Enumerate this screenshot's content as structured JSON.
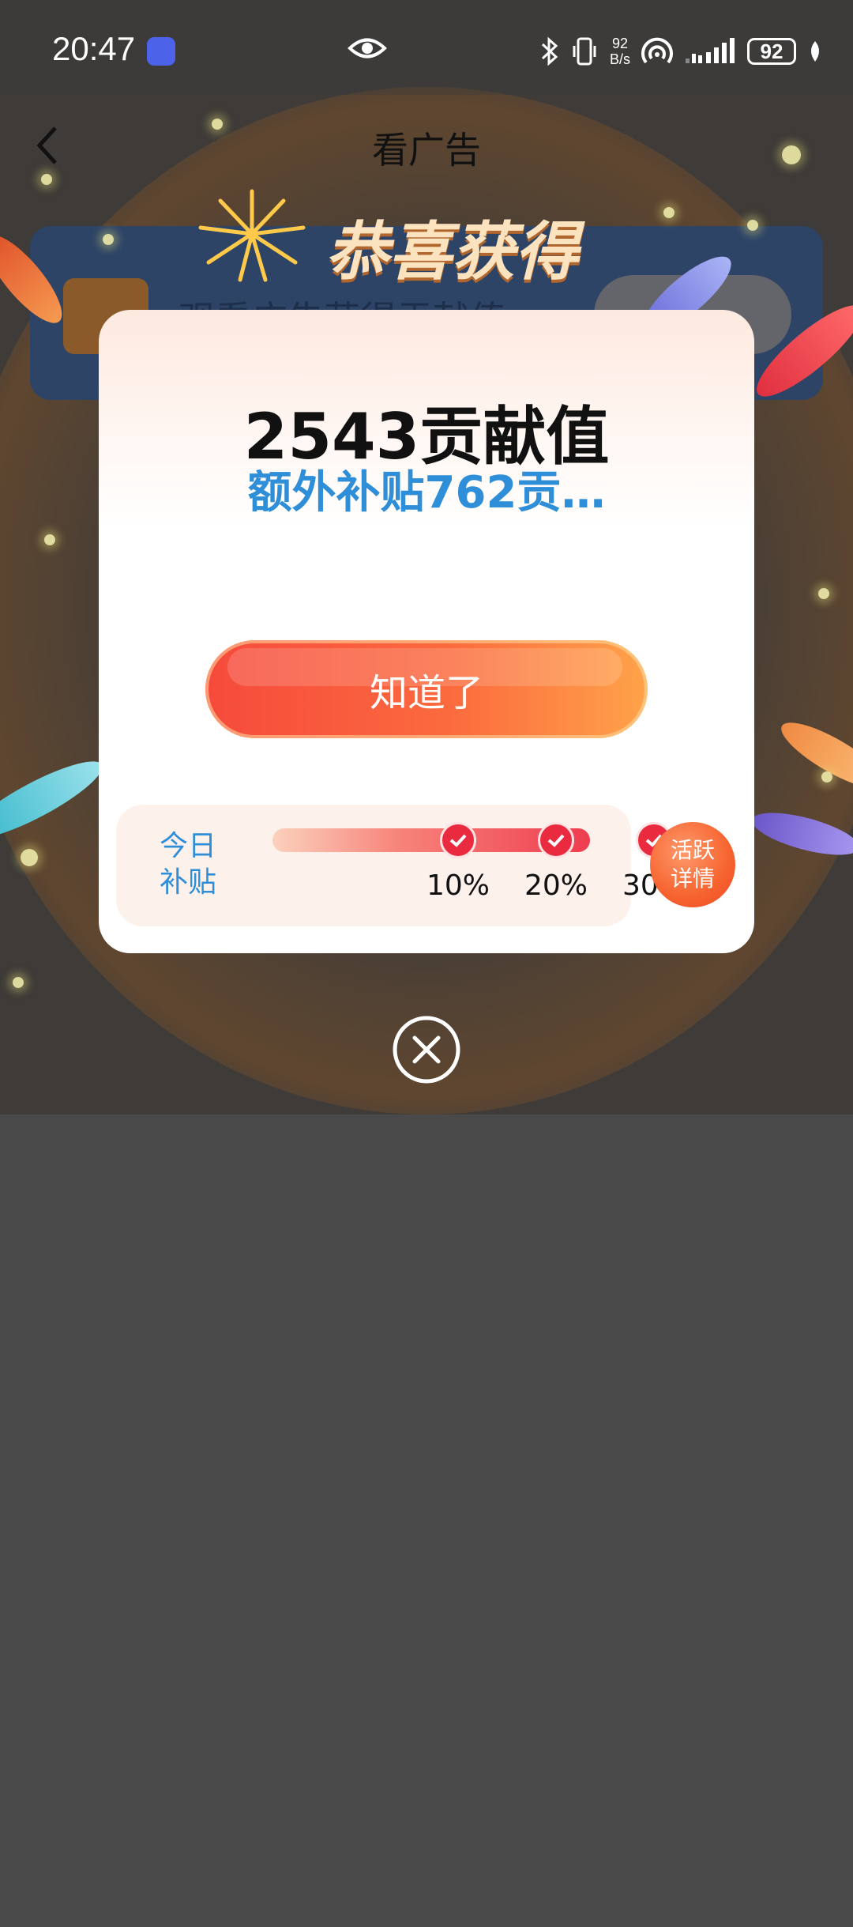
{
  "status_bar": {
    "time": "20:47",
    "net_speed_value": "92",
    "net_speed_unit": "B/s",
    "battery": "92"
  },
  "nav": {
    "title": "看广告"
  },
  "background_card": {
    "text": "观看广告获得贡献值"
  },
  "banner": {
    "title": "恭喜获得"
  },
  "modal": {
    "amount": "2543贡献值",
    "bonus": "额外补贴762贡…",
    "confirm_label": "知道了",
    "subsidy": {
      "label_line1": "今日",
      "label_line2": "补贴",
      "steps": [
        {
          "percent": "10%",
          "checked": true
        },
        {
          "percent": "20%",
          "checked": true
        },
        {
          "percent": "30%",
          "checked": true
        }
      ]
    },
    "detail_line1": "活跃",
    "detail_line2": "详情"
  },
  "colors": {
    "accent_blue": "#2f8ed8",
    "button_red": "#f64a3c",
    "button_orange": "#ffa34a",
    "check_red": "#ea2b3f"
  },
  "icons": [
    "app-notification-icon",
    "eye-icon",
    "bluetooth-icon",
    "vibrate-icon",
    "hotspot-icon",
    "signal-icon",
    "battery-icon",
    "leaf-icon",
    "back-arrow-icon",
    "treasure-chest-icon",
    "firework-icon",
    "check-icon",
    "close-icon"
  ]
}
